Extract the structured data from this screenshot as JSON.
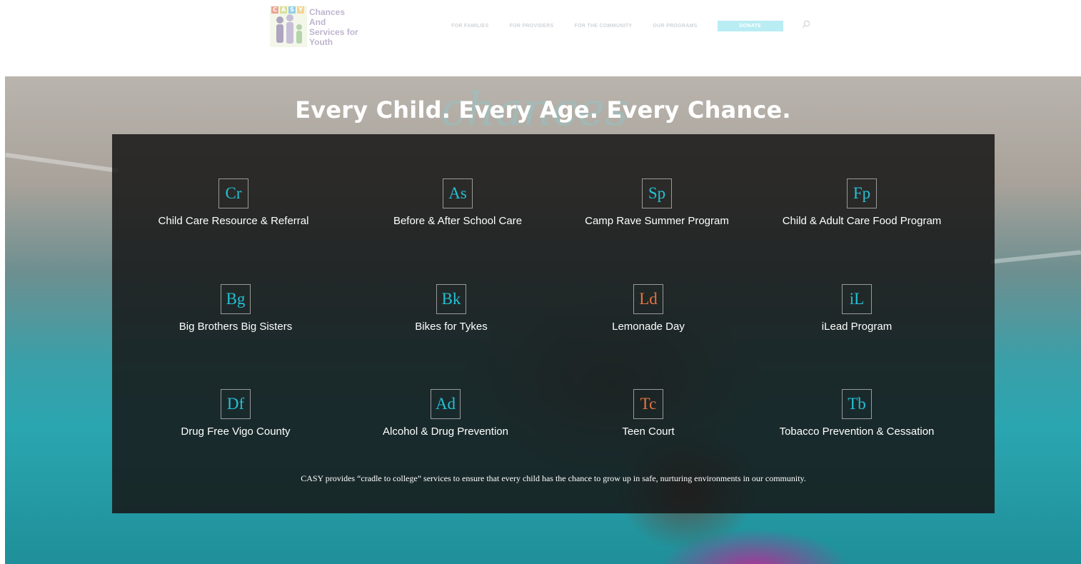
{
  "header": {
    "logo": {
      "letters": [
        "C",
        "A",
        "S",
        "Y"
      ],
      "letter_colors": [
        "#e05a3a",
        "#b8c94a",
        "#3aa9d6",
        "#f0b23c"
      ],
      "text_lines": [
        "Chances",
        "And",
        "Services for",
        "Youth"
      ]
    },
    "nav": [
      {
        "label": "FOR FAMILIES"
      },
      {
        "label": "FOR PROVIDERS"
      },
      {
        "label": "FOR THE COMMUNITY"
      },
      {
        "label": "OUR PROGRAMS"
      }
    ],
    "donate_label": "DONATE",
    "search_icon": "search-icon"
  },
  "hero": {
    "headline": "Every Child. Every Age. Every Chance.",
    "watermark": "chances",
    "programs": [
      {
        "abbr": "Cr",
        "label": "Child Care Resource & Referral",
        "color": "teal"
      },
      {
        "abbr": "As",
        "label": "Before & After School Care",
        "color": "teal"
      },
      {
        "abbr": "Sp",
        "label": "Camp Rave Summer Program",
        "color": "teal"
      },
      {
        "abbr": "Fp",
        "label": "Child & Adult Care Food Program",
        "color": "teal"
      },
      {
        "abbr": "Bg",
        "label": "Big Brothers Big Sisters",
        "color": "teal"
      },
      {
        "abbr": "Bk",
        "label": "Bikes for Tykes",
        "color": "teal"
      },
      {
        "abbr": "Ld",
        "label": "Lemonade Day",
        "color": "orange"
      },
      {
        "abbr": "iL",
        "label": "iLead Program",
        "color": "teal"
      },
      {
        "abbr": "Df",
        "label": "Drug Free Vigo County",
        "color": "teal"
      },
      {
        "abbr": "Ad",
        "label": "Alcohol & Drug Prevention",
        "color": "teal"
      },
      {
        "abbr": "Tc",
        "label": "Teen Court",
        "color": "orange"
      },
      {
        "abbr": "Tb",
        "label": "Tobacco Prevention & Cessation",
        "color": "teal"
      }
    ],
    "tagline": "CASY provides “cradle to college” services to ensure that every child has the chance to grow up in safe, nurturing environments in our community."
  },
  "colors": {
    "accent_teal": "#25c0d4",
    "accent_orange": "#e8733b",
    "donate_bg": "#b9ecf3"
  }
}
